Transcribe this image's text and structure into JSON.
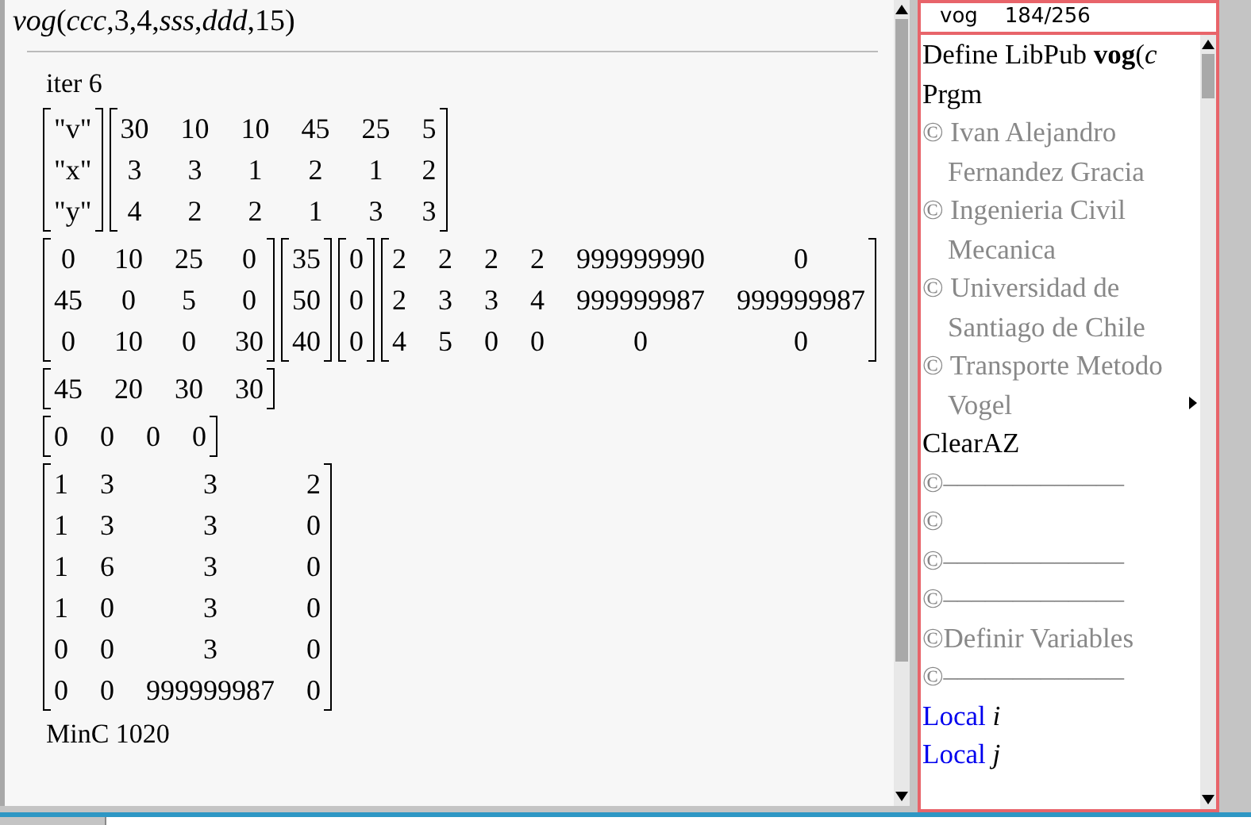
{
  "history": {
    "input": "*vog*(*ccc*,3,4,*sss*,*ddd*,15)",
    "outputs": [
      {
        "kind": "text",
        "text": "iter 6"
      },
      {
        "kind": "matrices",
        "matrices": [
          {
            "rows": [
              [
                "\"v\""
              ],
              [
                "\"x\""
              ],
              [
                "\"y\""
              ]
            ]
          },
          {
            "rows": [
              [
                "30",
                "10",
                "10",
                "45",
                "25",
                "5"
              ],
              [
                "3",
                "3",
                "1",
                "2",
                "1",
                "2"
              ],
              [
                "4",
                "2",
                "2",
                "1",
                "3",
                "3"
              ]
            ]
          }
        ]
      },
      {
        "kind": "matrices",
        "matrices": [
          {
            "rows": [
              [
                "0",
                "10",
                "25",
                "0"
              ],
              [
                "45",
                "0",
                "5",
                "0"
              ],
              [
                "0",
                "10",
                "0",
                "30"
              ]
            ]
          },
          {
            "rows": [
              [
                "35"
              ],
              [
                "50"
              ],
              [
                "40"
              ]
            ]
          },
          {
            "rows": [
              [
                "0"
              ],
              [
                "0"
              ],
              [
                "0"
              ]
            ]
          },
          {
            "rows": [
              [
                "2",
                "2",
                "2",
                "2",
                "999999990",
                "0"
              ],
              [
                "2",
                "3",
                "3",
                "4",
                "999999987",
                "999999987"
              ],
              [
                "4",
                "5",
                "0",
                "0",
                "0",
                "0"
              ]
            ]
          }
        ]
      },
      {
        "kind": "matrices",
        "matrices": [
          {
            "rows": [
              [
                "45",
                "20",
                "30",
                "30"
              ]
            ]
          }
        ]
      },
      {
        "kind": "matrices",
        "matrices": [
          {
            "rows": [
              [
                "0",
                "0",
                "0",
                "0"
              ]
            ]
          }
        ]
      },
      {
        "kind": "matrices",
        "matrices": [
          {
            "rows": [
              [
                "1",
                "3",
                "3",
                "2"
              ],
              [
                "1",
                "3",
                "3",
                "0"
              ],
              [
                "1",
                "6",
                "3",
                "0"
              ],
              [
                "1",
                "0",
                "3",
                "0"
              ],
              [
                "0",
                "0",
                "3",
                "0"
              ],
              [
                "0",
                "0",
                "999999987",
                "0"
              ]
            ]
          }
        ]
      },
      {
        "kind": "text",
        "text": "MinC 1020"
      }
    ]
  },
  "editor": {
    "name": "vog",
    "position": "184/256",
    "lines": [
      {
        "kind": "code",
        "text": "Define LibPub **vog**(*c*"
      },
      {
        "kind": "code",
        "text": "Prgm"
      },
      {
        "kind": "comment",
        "text": "© Ivan Alejandro Fernandez Gracia"
      },
      {
        "kind": "comment",
        "text": "© Ingenieria Civil Mecanica"
      },
      {
        "kind": "comment",
        "text": "© Universidad de Santiago de Chile"
      },
      {
        "kind": "comment",
        "text": "© Transporte Metodo Vogel"
      },
      {
        "kind": "code",
        "text": "ClearAZ"
      },
      {
        "kind": "comment",
        "text": "©–––––––––––––"
      },
      {
        "kind": "comment",
        "text": "©"
      },
      {
        "kind": "comment",
        "text": "©–––––––––––––"
      },
      {
        "kind": "comment",
        "text": "©–––––––––––––"
      },
      {
        "kind": "comment",
        "text": "©Definir Variables"
      },
      {
        "kind": "comment",
        "text": "©–––––––––––––"
      },
      {
        "kind": "local",
        "keyword": "Local",
        "text": "i"
      },
      {
        "kind": "local",
        "keyword": "Local",
        "text": "j"
      }
    ]
  }
}
